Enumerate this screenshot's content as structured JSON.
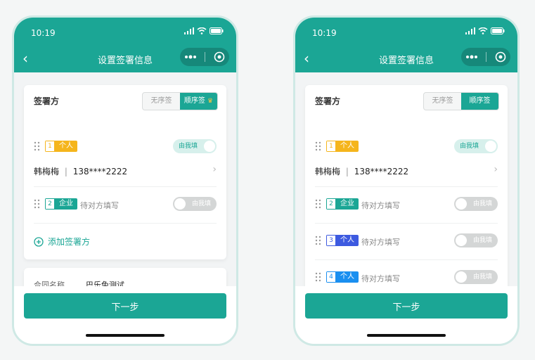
{
  "colors": {
    "primary": "#1ba695",
    "tag_yellow": "#f5b51c",
    "tag_teal": "#1ba695",
    "tag_indigo": "#3d5ae0",
    "tag_blue": "#1a8ff0"
  },
  "status": {
    "time": "10:19"
  },
  "nav": {
    "title": "设置签署信息"
  },
  "signers": {
    "title": "签署方",
    "mode_unordered": "无序签",
    "mode_ordered": "顺序签"
  },
  "left": {
    "parties": [
      {
        "num": "1",
        "type": "个人",
        "toggle": "由我填",
        "name": "韩梅梅",
        "phone": "138****2222"
      },
      {
        "num": "2",
        "type": "企业",
        "pending": "待对方填写",
        "toggle": "由我填"
      }
    ],
    "add_label": "添加签署方",
    "contract_label": "合同名称",
    "contract_value": "巴乐兔测试"
  },
  "right": {
    "parties": [
      {
        "num": "1",
        "type": "个人",
        "toggle": "由我填",
        "name": "韩梅梅",
        "phone": "138****2222"
      },
      {
        "num": "2",
        "type": "企业",
        "pending": "待对方填写",
        "toggle": "由我填"
      },
      {
        "num": "3",
        "type": "个人",
        "pending": "待对方填写",
        "toggle": "由我填"
      },
      {
        "num": "4",
        "type": "个人",
        "pending": "待对方填写",
        "toggle": "由我填"
      }
    ]
  },
  "bottom": {
    "next_label": "下一步"
  }
}
